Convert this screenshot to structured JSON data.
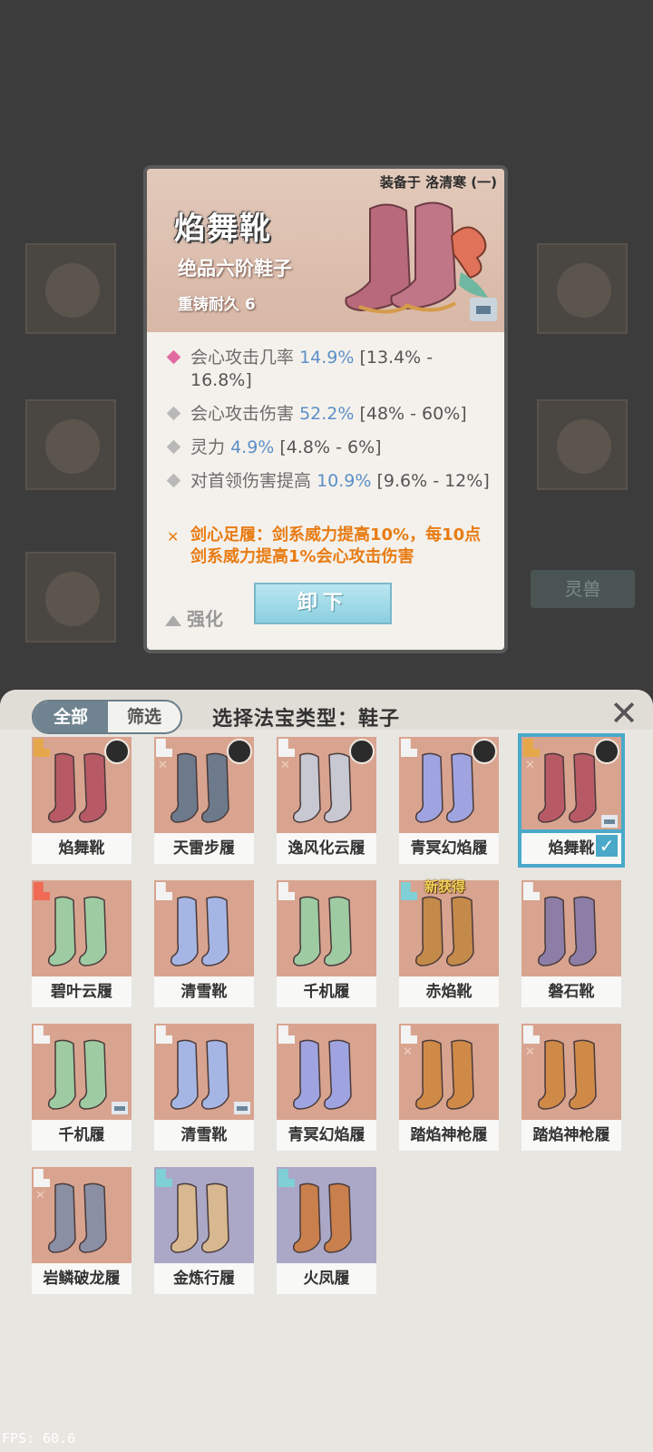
{
  "background": {
    "beast_button": "灵兽"
  },
  "tooltip": {
    "equipped_to": "装备于 洛清寒 (一)",
    "title": "焰舞靴",
    "grade": "绝品六阶鞋子",
    "recast": "重铸耐久 6",
    "attributes": [
      {
        "name": "会心攻击几率",
        "value": "14.9%",
        "range": "[13.4% - 16.8%]",
        "marker": "pink"
      },
      {
        "name": "会心攻击伤害",
        "value": "52.2%",
        "range": "[48% - 60%]",
        "marker": "gray"
      },
      {
        "name": "灵力",
        "value": "4.9%",
        "range": "[4.8% - 6%]",
        "marker": "gray"
      },
      {
        "name": "对首领伤害提高",
        "value": "10.9%",
        "range": "[9.6% - 12%]",
        "marker": "gray"
      }
    ],
    "special_effect": "剑心足履：剑系威力提高10%，每10点剑系威力提高1%会心攻击伤害",
    "enhance_label": "强化",
    "unequip_label": "卸下"
  },
  "panel": {
    "tab_all": "全部",
    "tab_filter": "筛选",
    "type_label": "选择法宝类型：鞋子",
    "close_icon": "close-icon"
  },
  "items": [
    {
      "name": "焰舞靴",
      "quality": "gold",
      "avatar": true,
      "sword": false,
      "lock": false,
      "bg": "red",
      "new": false,
      "selected": false,
      "color": "#b75a66"
    },
    {
      "name": "天雷步履",
      "quality": "white",
      "avatar": true,
      "sword": true,
      "lock": false,
      "bg": "red",
      "new": false,
      "selected": false,
      "color": "#6d7a8c"
    },
    {
      "name": "逸风化云履",
      "quality": "white",
      "avatar": true,
      "sword": true,
      "lock": false,
      "bg": "red",
      "new": false,
      "selected": false,
      "color": "#c8c8d2"
    },
    {
      "name": "青冥幻焰履",
      "quality": "white",
      "avatar": true,
      "sword": false,
      "lock": false,
      "bg": "red",
      "new": false,
      "selected": false,
      "color": "#9fa4e0"
    },
    {
      "name": "焰舞靴",
      "quality": "gold",
      "avatar": true,
      "sword": true,
      "lock": true,
      "bg": "red",
      "new": false,
      "selected": true,
      "color": "#b75a66"
    },
    {
      "name": "碧叶云履",
      "quality": "red",
      "avatar": false,
      "sword": false,
      "lock": false,
      "bg": "red",
      "new": false,
      "selected": false,
      "color": "#9ecba2"
    },
    {
      "name": "清雪靴",
      "quality": "white",
      "avatar": false,
      "sword": false,
      "lock": false,
      "bg": "red",
      "new": false,
      "selected": false,
      "color": "#a6b6e4"
    },
    {
      "name": "千机履",
      "quality": "white",
      "avatar": false,
      "sword": false,
      "lock": false,
      "bg": "red",
      "new": false,
      "selected": false,
      "color": "#9ecba2"
    },
    {
      "name": "赤焰靴",
      "quality": "teal",
      "avatar": false,
      "sword": false,
      "lock": false,
      "bg": "red",
      "new": true,
      "selected": false,
      "color": "#c48a4a",
      "new_label": "新获得"
    },
    {
      "name": "磐石靴",
      "quality": "white",
      "avatar": false,
      "sword": false,
      "lock": false,
      "bg": "red",
      "new": false,
      "selected": false,
      "color": "#8c7ea6"
    },
    {
      "name": "千机履",
      "quality": "white",
      "avatar": false,
      "sword": false,
      "lock": true,
      "bg": "red",
      "new": false,
      "selected": false,
      "color": "#9ecba2"
    },
    {
      "name": "清雪靴",
      "quality": "white",
      "avatar": false,
      "sword": false,
      "lock": true,
      "bg": "red",
      "new": false,
      "selected": false,
      "color": "#a6b6e4"
    },
    {
      "name": "青冥幻焰履",
      "quality": "white",
      "avatar": false,
      "sword": false,
      "lock": false,
      "bg": "red",
      "new": false,
      "selected": false,
      "color": "#9fa4e0"
    },
    {
      "name": "踏焰神枪履",
      "quality": "white",
      "avatar": false,
      "sword": true,
      "lock": false,
      "bg": "red",
      "new": false,
      "selected": false,
      "color": "#d08a48"
    },
    {
      "name": "踏焰神枪履",
      "quality": "white",
      "avatar": false,
      "sword": true,
      "lock": false,
      "bg": "red",
      "new": false,
      "selected": false,
      "color": "#d08a48"
    },
    {
      "name": "岩鳞破龙履",
      "quality": "white",
      "avatar": false,
      "sword": true,
      "lock": false,
      "bg": "red",
      "new": false,
      "selected": false,
      "color": "#8b8fa4"
    },
    {
      "name": "金炼行履",
      "quality": "teal",
      "avatar": false,
      "sword": false,
      "lock": false,
      "bg": "blue",
      "new": false,
      "selected": false,
      "color": "#d8b890"
    },
    {
      "name": "火凤履",
      "quality": "teal",
      "avatar": false,
      "sword": false,
      "lock": false,
      "bg": "blue",
      "new": false,
      "selected": false,
      "color": "#c9804c"
    }
  ],
  "fps": "FPS: 60.6"
}
